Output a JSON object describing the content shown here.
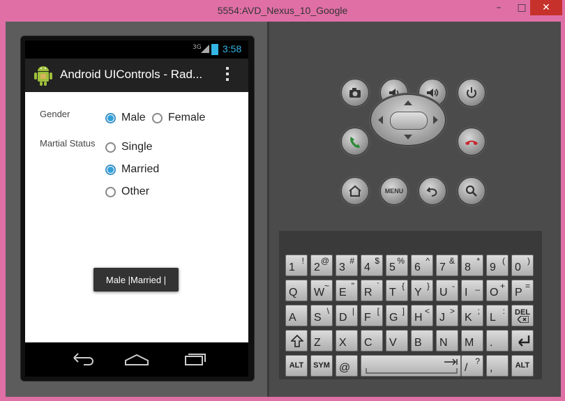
{
  "window": {
    "title": "5554:AVD_Nexus_10_Google",
    "minimize": "–",
    "maximize": "□",
    "close": "✕"
  },
  "status_bar": {
    "network": "3G",
    "time": "3:58"
  },
  "action_bar": {
    "title": "Android UIControls - Rad...",
    "app_icon": "android-robot-icon",
    "overflow_icon": "overflow-menu-icon"
  },
  "form": {
    "gender_label": "Gender",
    "gender_options": [
      {
        "label": "Male",
        "checked": true
      },
      {
        "label": "Female",
        "checked": false
      }
    ],
    "status_label": "Martial Status",
    "status_options": [
      {
        "label": "Single",
        "checked": false
      },
      {
        "label": "Married",
        "checked": true
      },
      {
        "label": "Other",
        "checked": false
      }
    ]
  },
  "toast": {
    "text": "Male |Married |"
  },
  "nav_icons": [
    "back-icon",
    "home-icon",
    "recents-icon"
  ],
  "controls": {
    "row1": [
      "camera-icon",
      "volume-down-icon",
      "volume-up-icon",
      "power-icon"
    ],
    "call": "call-icon",
    "end_call": "end-call-icon",
    "row3": [
      "home-icon",
      "menu-button",
      "back-icon",
      "search-icon"
    ],
    "menu_label": "MENU"
  },
  "keyboard": {
    "row1": [
      [
        "1",
        "!"
      ],
      [
        "2",
        "@"
      ],
      [
        "3",
        "#"
      ],
      [
        "4",
        "$"
      ],
      [
        "5",
        "%"
      ],
      [
        "6",
        "^"
      ],
      [
        "7",
        "&"
      ],
      [
        "8",
        "*"
      ],
      [
        "9",
        "("
      ],
      [
        "0",
        ")"
      ]
    ],
    "row2": [
      [
        "Q",
        ""
      ],
      [
        "W",
        "~"
      ],
      [
        "E",
        "\""
      ],
      [
        "R",
        "`"
      ],
      [
        "T",
        "{"
      ],
      [
        "Y",
        "}"
      ],
      [
        "U",
        "-"
      ],
      [
        "I",
        "_"
      ],
      [
        "O",
        "+"
      ],
      [
        "P",
        "="
      ]
    ],
    "row3": [
      [
        "A",
        ""
      ],
      [
        "S",
        "\\"
      ],
      [
        "D",
        "|"
      ],
      [
        "F",
        "["
      ],
      [
        "G",
        "]"
      ],
      [
        "H",
        "<"
      ],
      [
        "J",
        ">"
      ],
      [
        "K",
        ";"
      ],
      [
        "L",
        ":"
      ],
      [
        "DEL",
        ""
      ]
    ],
    "row4": [
      [
        "shift",
        ""
      ],
      [
        "Z",
        ""
      ],
      [
        "X",
        ""
      ],
      [
        "C",
        ""
      ],
      [
        "V",
        ""
      ],
      [
        "B",
        ""
      ],
      [
        "N",
        ""
      ],
      [
        "M",
        ""
      ],
      [
        ".",
        ""
      ],
      [
        "enter",
        ""
      ]
    ],
    "row5": [
      [
        "ALT",
        ""
      ],
      [
        "SYM",
        ""
      ],
      [
        "@",
        ""
      ],
      [
        "space",
        ""
      ],
      [
        "/",
        "?"
      ],
      [
        ",",
        ""
      ],
      [
        "ALT",
        ""
      ]
    ]
  }
}
